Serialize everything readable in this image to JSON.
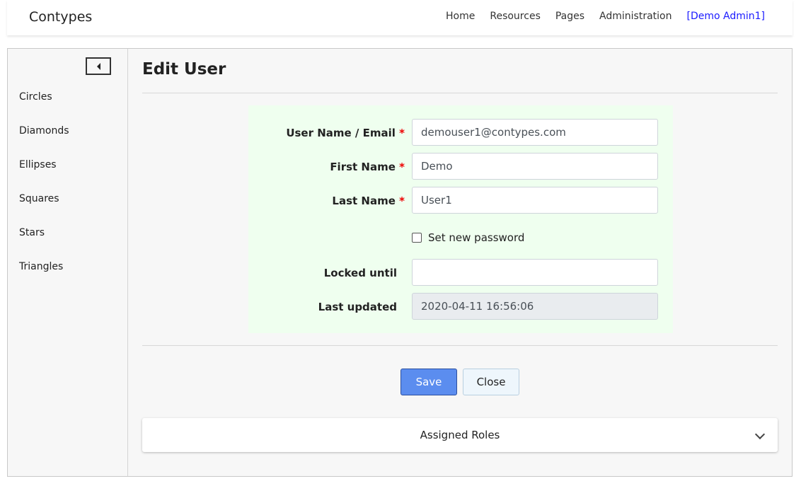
{
  "navbar": {
    "brand": "Contypes",
    "links": [
      "Home",
      "Resources",
      "Pages",
      "Administration"
    ],
    "user": "[Demo Admin1]"
  },
  "sidebar": {
    "items": [
      "Circles",
      "Diamonds",
      "Ellipses",
      "Squares",
      "Stars",
      "Triangles"
    ]
  },
  "page": {
    "title": "Edit User"
  },
  "form": {
    "username_label": "User Name / Email",
    "username_value": "demouser1@contypes.com",
    "firstname_label": "First Name",
    "firstname_value": "Demo",
    "lastname_label": "Last Name",
    "lastname_value": "User1",
    "required_mark": "*",
    "set_password_label": "Set new password",
    "set_password_checked": false,
    "locked_until_label": "Locked until",
    "locked_until_value": "",
    "last_updated_label": "Last updated",
    "last_updated_value": "2020-04-11 16:56:06"
  },
  "actions": {
    "save_label": "Save",
    "close_label": "Close"
  },
  "roles": {
    "label": "Assigned Roles"
  },
  "colors": {
    "form_panel_bg": "#efffef",
    "save_button": "#5b8def",
    "user_link": "#1a1aff",
    "required": "#ee0000"
  }
}
